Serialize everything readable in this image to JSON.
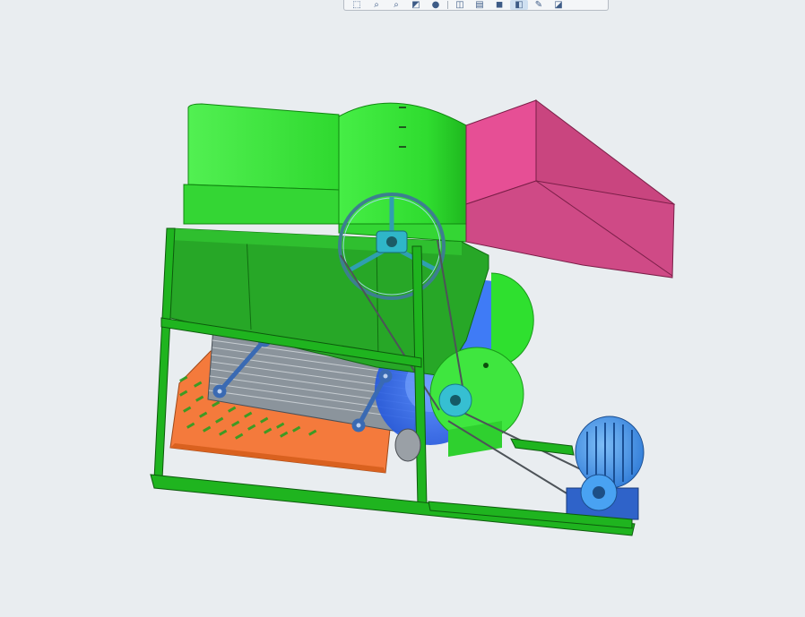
{
  "toolbar": {
    "buttons": [
      {
        "name": "zoom-window-icon",
        "glyph": "⬚"
      },
      {
        "name": "zoom-in-icon",
        "glyph": "⌕"
      },
      {
        "name": "zoom-out-icon",
        "glyph": "⌕"
      },
      {
        "name": "view-orientation-icon",
        "glyph": "◩"
      },
      {
        "name": "shaded-display-icon",
        "glyph": "●"
      },
      {
        "name": "section-view-icon",
        "glyph": "◫"
      },
      {
        "name": "hide-show-icon",
        "glyph": "▤"
      },
      {
        "name": "render-tools-icon",
        "glyph": "◼"
      },
      {
        "name": "view-settings-icon",
        "glyph": "◧"
      },
      {
        "name": "appearance-icon",
        "glyph": "✎"
      },
      {
        "name": "display-style-icon",
        "glyph": "◪"
      }
    ],
    "active_index": 8
  },
  "colors": {
    "background": "#e9edf0",
    "frame_green": "#1fb41f",
    "hopper_green": "#3ee93e",
    "body_green": "#27a727",
    "chute_magenta": "#d84c8a",
    "tray_orange": "#f47a3c",
    "fan_blue": "#2f6bf5",
    "motor_blue": "#3e8fe8",
    "pulley_cyan": "#2fb6c8",
    "sieve_grey": "#8b949c",
    "bracket_blue": "#5a88c8"
  }
}
